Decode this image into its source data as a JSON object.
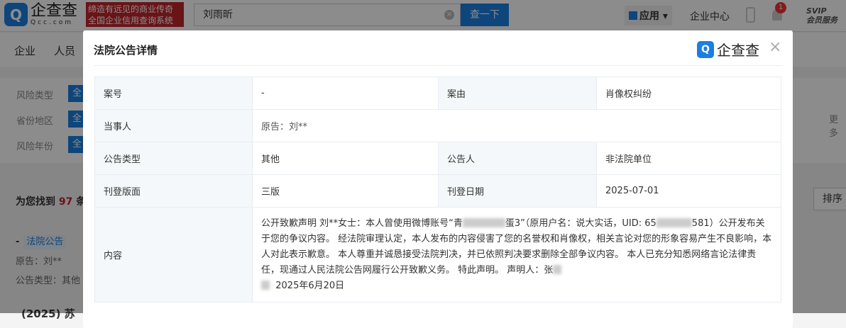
{
  "header": {
    "logo_text": "企查查",
    "logo_sub": "Qcc.com",
    "slogan_1": "缔造有远见的商业传奇",
    "slogan_2": "全国企业信用查询系统",
    "search_value": "刘雨昕",
    "search_button": "查一下",
    "apps": "应用",
    "enterprise_center": "企业中心",
    "notification_count": "1",
    "svip": "SVIP",
    "svip_sub": "会员服务"
  },
  "nav": {
    "items": [
      "企业",
      "人员"
    ]
  },
  "filters": {
    "rows": [
      {
        "label": "风险类型",
        "btn": "全"
      },
      {
        "label": "省份地区",
        "btn": "全"
      },
      {
        "label": "风险年份",
        "btn": "全"
      }
    ],
    "more": "更多"
  },
  "results": {
    "prefix": "为您找到",
    "count": "97",
    "suffix": "条",
    "sort": "排序",
    "item_dash": "-",
    "item_tag": "法院公告",
    "item_plaintiff": "原告：刘**",
    "item_type": "公告类型：其他",
    "next_item": "(2025) 苏"
  },
  "modal": {
    "title": "法院公告详情",
    "logo_text": "企查查",
    "close": "×",
    "rows": {
      "case_no_label": "案号",
      "case_no": "-",
      "cause_label": "案由",
      "cause": "肖像权纠纷",
      "party_label": "当事人",
      "party": "原告：刘**",
      "type_label": "公告类型",
      "type": "其他",
      "announcer_label": "公告人",
      "announcer": "非法院单位",
      "page_label": "刊登版面",
      "page": "三版",
      "date_label": "刊登日期",
      "date": "2025-07-01",
      "content_label": "内容",
      "content_1": "公开致歉声明 刘**女士：本人曾使用微博账号“青",
      "content_2": "蛋3”（原用户名：说大实话，UID: 65",
      "content_3": "581）公开发布关于您的争议内容。 经法院审理认定，本人发布的内容侵害了您的名誉权和肖像权，相关言论对您的形象容易产生不良影响，本人对此表示歉意。 本人尊重并诚恳接受法院判决，并已依照判决要求删除全部争议内容。 本人已充分知悉网络言论法律责任，现通过人民法院公告网履行公开致歉义务。 特此声明。 声明人：张",
      "content_4": "2025年6月20日"
    }
  }
}
